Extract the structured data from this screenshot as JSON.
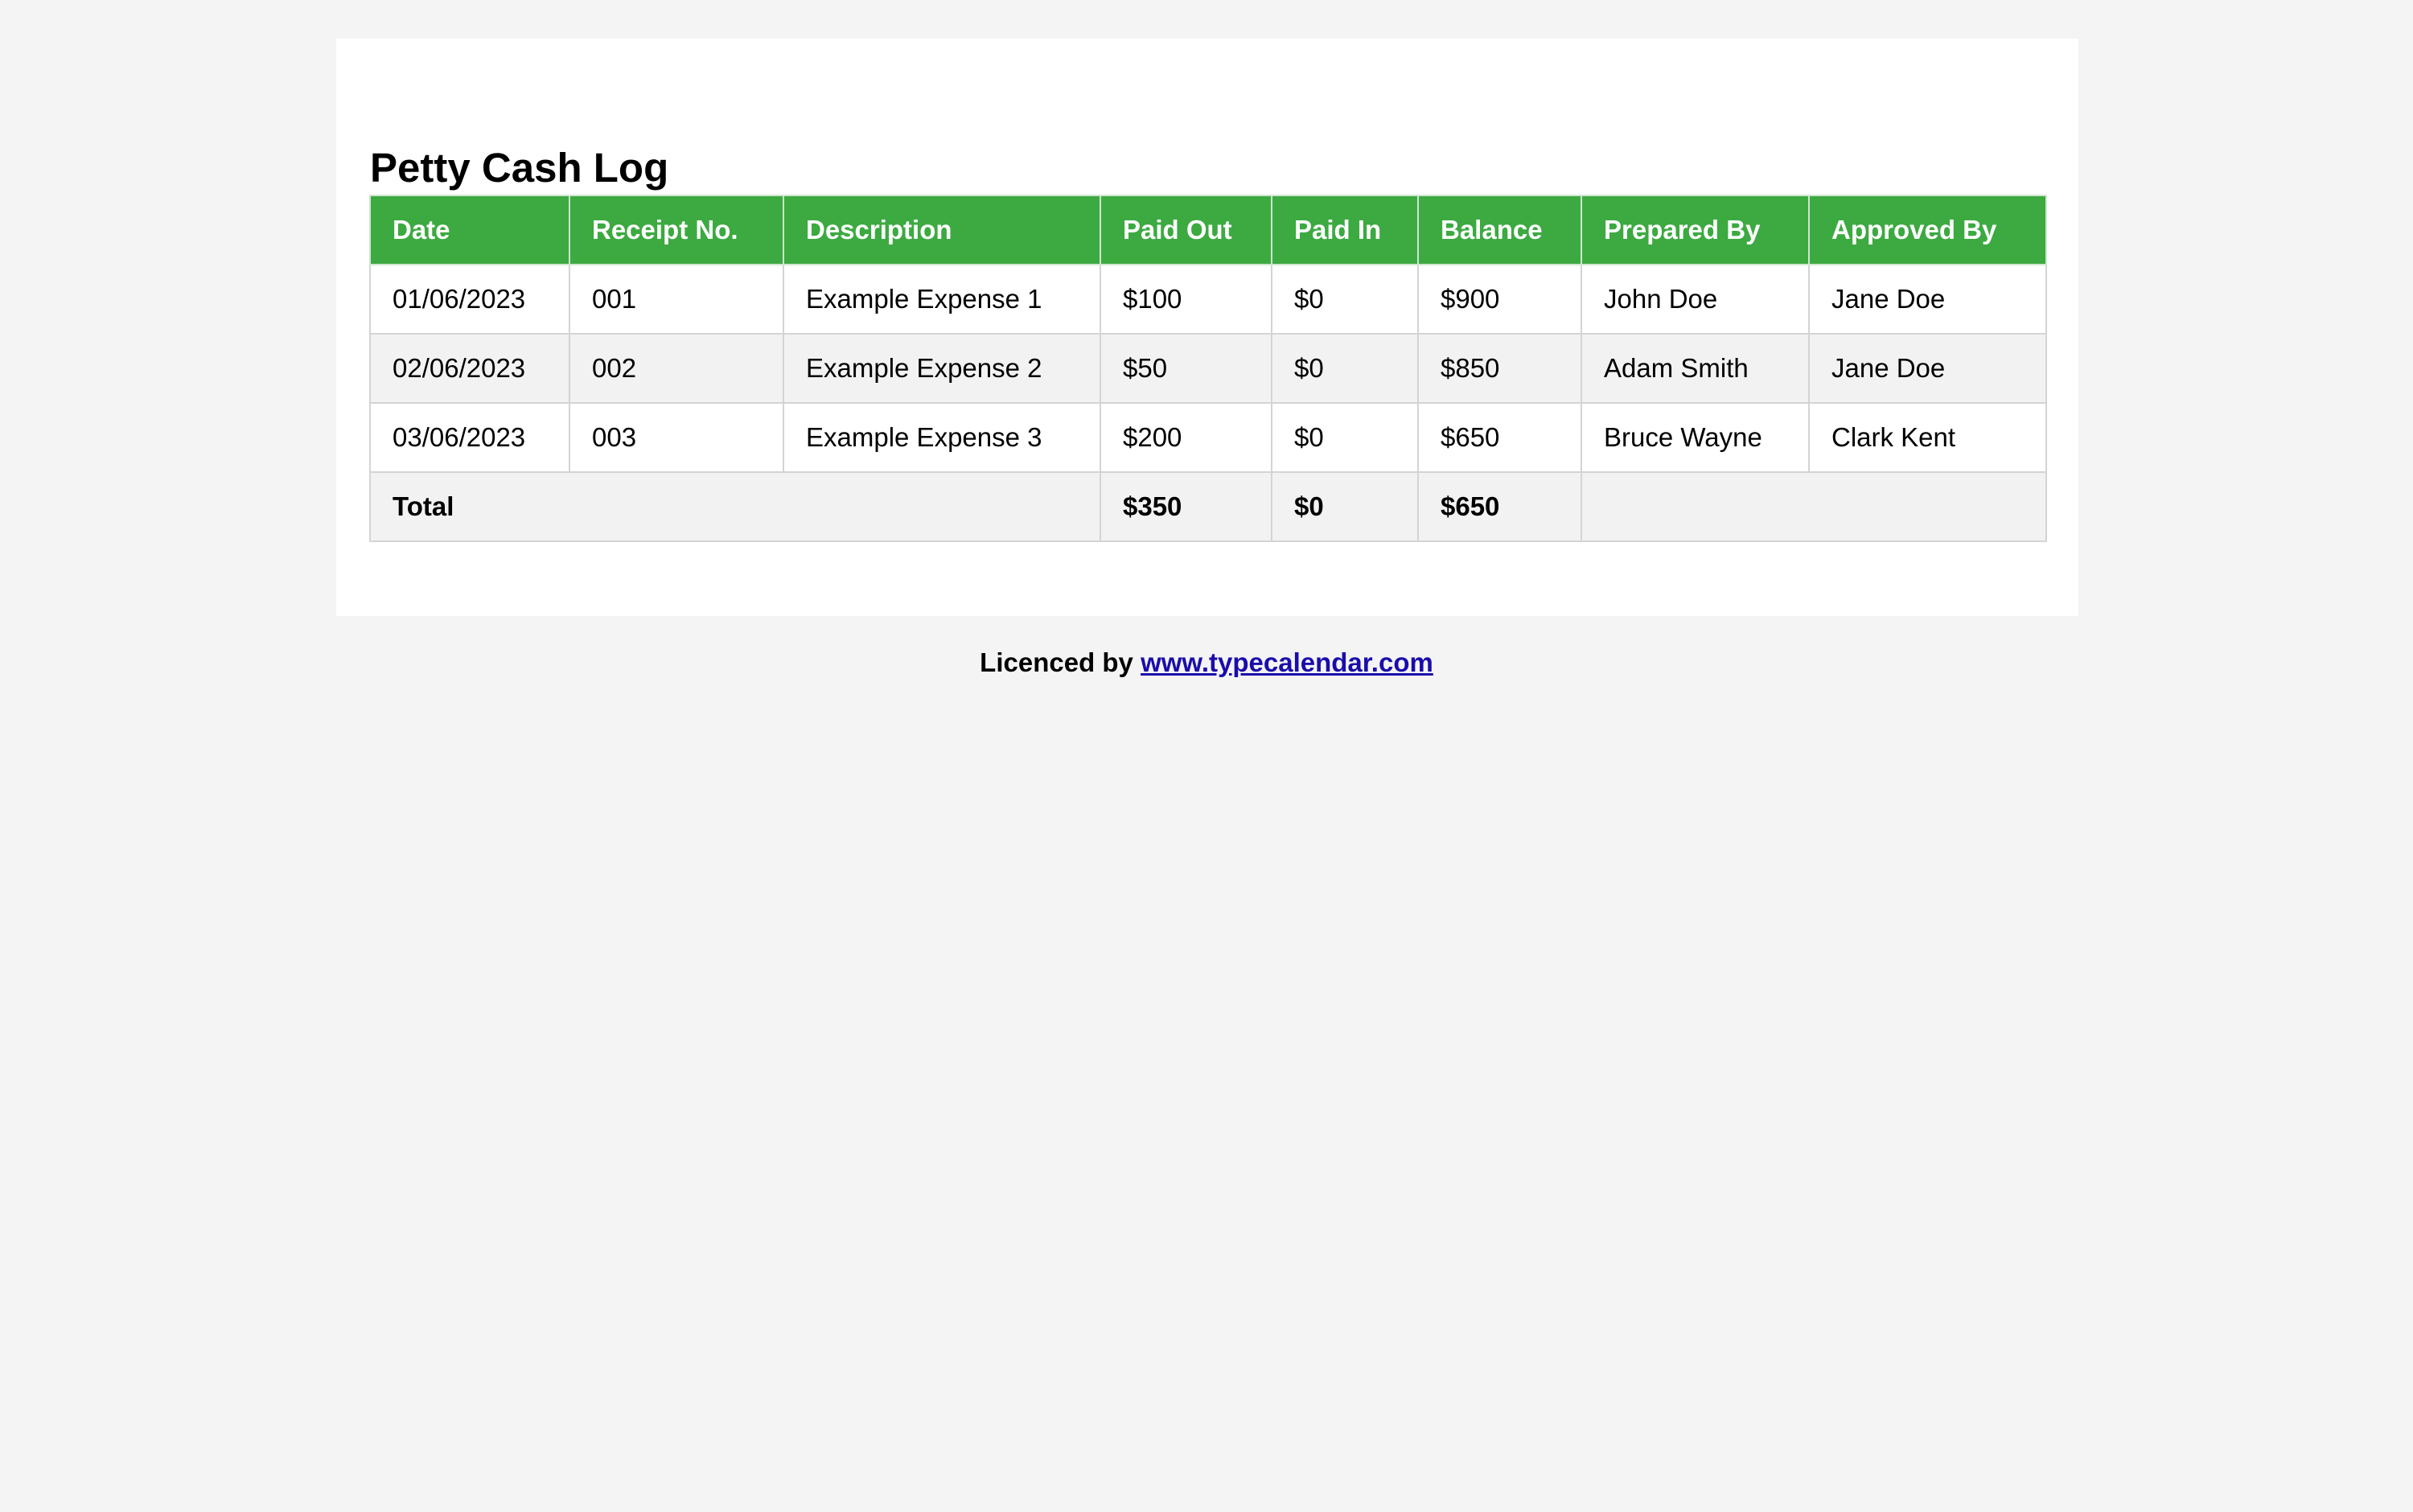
{
  "title": "Petty Cash Log",
  "table": {
    "headers": {
      "date": "Date",
      "receipt": "Receipt No.",
      "description": "Description",
      "paid_out": "Paid Out",
      "paid_in": "Paid In",
      "balance": "Balance",
      "prepared_by": "Prepared By",
      "approved_by": "Approved By"
    },
    "rows": [
      {
        "date": "01/06/2023",
        "receipt": "001",
        "description": "Example Expense 1",
        "paid_out": "$100",
        "paid_in": "$0",
        "balance": "$900",
        "prepared_by": "John Doe",
        "approved_by": "Jane Doe"
      },
      {
        "date": "02/06/2023",
        "receipt": "002",
        "description": "Example Expense 2",
        "paid_out": "$50",
        "paid_in": "$0",
        "balance": "$850",
        "prepared_by": "Adam Smith",
        "approved_by": "Jane Doe"
      },
      {
        "date": "03/06/2023",
        "receipt": "003",
        "description": "Example Expense 3",
        "paid_out": "$200",
        "paid_in": "$0",
        "balance": "$650",
        "prepared_by": "Bruce Wayne",
        "approved_by": "Clark Kent"
      }
    ],
    "total": {
      "label": "Total",
      "paid_out": "$350",
      "paid_in": "$0",
      "balance": "$650"
    }
  },
  "footer": {
    "prefix": "Licenced by",
    "link_text": "www.typecalendar.com"
  },
  "colors": {
    "header_bg": "#3caa41",
    "header_text": "#ffffff",
    "page_bg": "#f4f4f4",
    "stripe_bg": "#f2f2f2",
    "link": "#1a0dab"
  }
}
